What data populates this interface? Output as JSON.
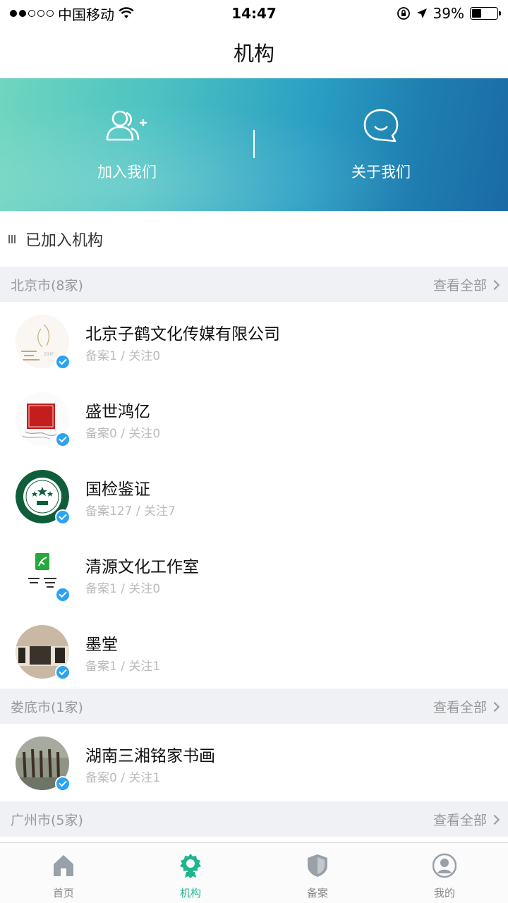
{
  "status_bar": {
    "carrier": "中国移动",
    "time": "14:47",
    "battery": "39%",
    "battery_level": 0.39
  },
  "nav": {
    "title": "机构"
  },
  "banner": {
    "join_label": "加入我们",
    "about_label": "关于我们"
  },
  "section": {
    "title": "已加入机构"
  },
  "view_all_label": "查看全部",
  "groups": [
    {
      "city": "北京市(8家)",
      "orgs": [
        {
          "name": "北京子鹤文化传媒有限公司",
          "meta": "备案1 / 关注0"
        },
        {
          "name": "盛世鸿亿",
          "meta": "备案0 / 关注0"
        },
        {
          "name": "国检鉴证",
          "meta": "备案127 / 关注7"
        },
        {
          "name": "清源文化工作室",
          "meta": "备案1 / 关注0"
        },
        {
          "name": "墨堂",
          "meta": "备案1 / 关注1"
        }
      ]
    },
    {
      "city": "娄底市(1家)",
      "orgs": [
        {
          "name": "湖南三湘铭家书画",
          "meta": "备案0 / 关注1"
        }
      ]
    },
    {
      "city": "广州市(5家)",
      "orgs": []
    }
  ],
  "tabs": [
    {
      "label": "首页",
      "icon": "home-icon"
    },
    {
      "label": "机构",
      "icon": "institution-icon",
      "active": true
    },
    {
      "label": "备案",
      "icon": "shield-icon"
    },
    {
      "label": "我的",
      "icon": "profile-icon"
    }
  ],
  "colors": {
    "accent": "#1fb58f",
    "verify": "#2ba3f1"
  }
}
